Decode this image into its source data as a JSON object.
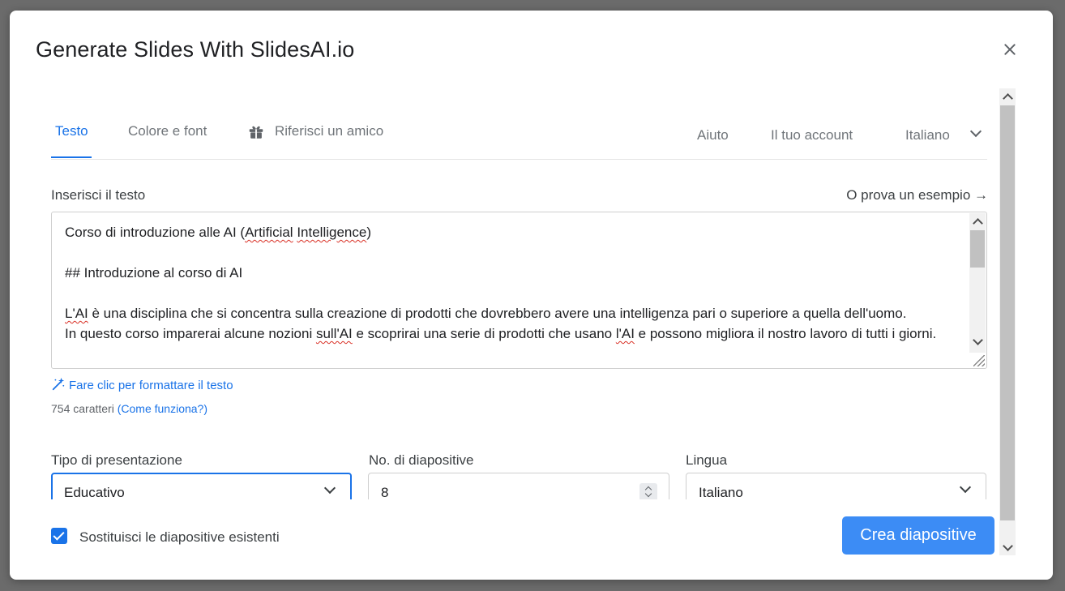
{
  "dialog": {
    "title": "Generate Slides With SlidesAI.io"
  },
  "tabs": [
    {
      "label": "Testo",
      "active": true
    },
    {
      "label": "Colore e font",
      "active": false
    },
    {
      "label": "Riferisci un amico",
      "active": false,
      "icon": "gift-icon"
    }
  ],
  "nav": {
    "help": "Aiuto",
    "account": "Il tuo account",
    "language": "Italiano"
  },
  "input_section": {
    "label": "Inserisci il testo",
    "example_link": "O prova un esempio →",
    "text_lines": [
      "Corso di introduzione alle AI (Artificial Intelligence)",
      "",
      "## Introduzione al corso di AI",
      "",
      "L'AI è una disciplina che si concentra sulla creazione di prodotti che dovrebbero avere una intelligenza pari o superiore a quella dell'uomo.",
      "In questo corso imparerai alcune nozioni sull'AI e scoprirai una serie di prodotti che usano l'AI e possono migliora il nostro lavoro di tutti i giorni."
    ],
    "format_link": "Fare clic per formattare il testo",
    "char_count": "754 caratteri",
    "how_link": "(Come funziona?)"
  },
  "options": {
    "presentation_type": {
      "label": "Tipo di presentazione",
      "value": "Educativo"
    },
    "slide_count": {
      "label": "No. di diapositive",
      "value": "8"
    },
    "language": {
      "label": "Lingua",
      "value": "Italiano"
    }
  },
  "footer": {
    "replace_checkbox": {
      "label": "Sostituisci le diapositive esistenti",
      "checked": true
    },
    "create_button": "Crea diapositive"
  },
  "colors": {
    "accent": "#1a73e8",
    "button": "#3c8cf5"
  }
}
